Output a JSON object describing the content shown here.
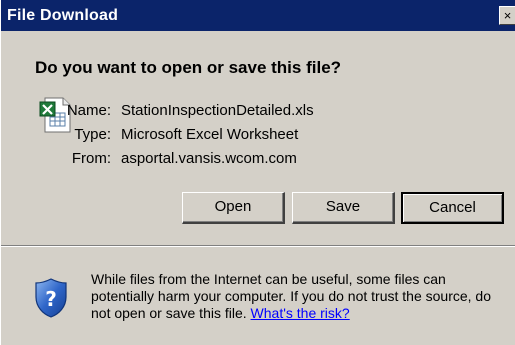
{
  "window": {
    "title": "File Download",
    "close_label": "×"
  },
  "prompt": {
    "question": "Do you want to open or save this file?"
  },
  "file": {
    "icon": "excel-file-icon",
    "name_label": "Name:",
    "name_value": "StationInspectionDetailed.xls",
    "type_label": "Type:",
    "type_value": "Microsoft Excel Worksheet",
    "from_label": "From:",
    "from_value": "asportal.vansis.wcom.com"
  },
  "buttons": {
    "open_label": "Open",
    "save_label": "Save",
    "cancel_label": "Cancel"
  },
  "warning": {
    "icon": "security-shield-question-icon",
    "text": "While files from the Internet can be useful, some files can potentially harm your computer. If you do not trust the source, do not open or save this file. ",
    "link_text": "What's the risk?"
  },
  "colors": {
    "titlebar": "#0b246a",
    "dialog_bg": "#d4d0c8",
    "link": "#0000ff"
  }
}
